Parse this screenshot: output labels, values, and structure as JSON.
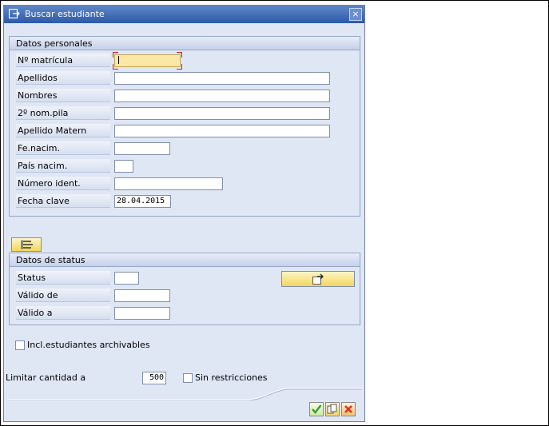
{
  "window": {
    "title": "Buscar estudiante",
    "close_label": "×"
  },
  "personal": {
    "header": "Datos personales",
    "fields": [
      {
        "label": "Nº matrícula",
        "value": ""
      },
      {
        "label": "Apellidos",
        "value": ""
      },
      {
        "label": "Nombres",
        "value": ""
      },
      {
        "label": "2º nom.pila",
        "value": ""
      },
      {
        "label": "Apellido Matern",
        "value": ""
      },
      {
        "label": "Fe.nacim.",
        "value": ""
      },
      {
        "label": "País nacim.",
        "value": ""
      },
      {
        "label": "Número ident.",
        "value": ""
      },
      {
        "label": "Fecha clave",
        "value": "28.04.2015"
      }
    ]
  },
  "status": {
    "header": "Datos de status",
    "fields": [
      {
        "label": "Status",
        "value": ""
      },
      {
        "label": "Válido de",
        "value": ""
      },
      {
        "label": "Válido a",
        "value": ""
      }
    ]
  },
  "archivable_label": "Incl.estudiantes archivables",
  "limit": {
    "label": "Limitar cantidad a",
    "value": "500",
    "no_restrictions_label": "Sin restricciones"
  },
  "icons": {
    "title": "dialog-icon",
    "toggle": "collapse-panel-icon",
    "status_action": "status-action-icon",
    "ok": "checkmark-icon",
    "copy": "copy-icon",
    "cancel": "cancel-icon"
  },
  "colors": {
    "title_bar": "#2c5aa8",
    "focus_field": "#fde7a6",
    "button_yellow": "#f3d65c",
    "ok_green": "#3b9b2a",
    "cancel_red": "#d9381e"
  }
}
